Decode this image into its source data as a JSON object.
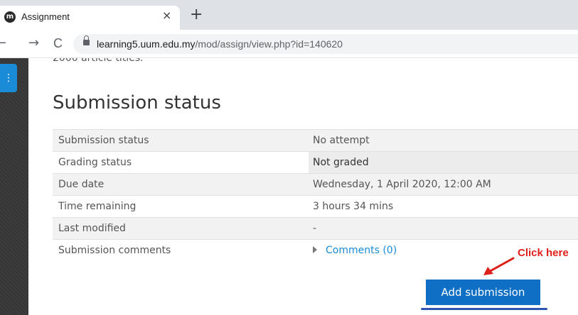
{
  "browser": {
    "tab_title": "Assignment",
    "tab_close": "×",
    "new_tab": "+",
    "back": "←",
    "forward": "→",
    "reload": "C",
    "url_host": "learning5.uum.edu.my",
    "url_path": "/mod/assign/view.php?id=140620",
    "favicon": "m"
  },
  "page": {
    "cut_off_text": "2000 article titles.",
    "heading": "Submission status",
    "rows": [
      {
        "label": "Submission status",
        "value": "No attempt"
      },
      {
        "label": "Grading status",
        "value": "Not graded"
      },
      {
        "label": "Due date",
        "value": "Wednesday, 1 April 2020, 12:00 AM"
      },
      {
        "label": "Time remaining",
        "value": "3 hours 34 mins"
      },
      {
        "label": "Last modified",
        "value": "-"
      },
      {
        "label": "Submission comments",
        "value": "Comments (0)"
      }
    ],
    "add_submission_label": "Add submission"
  },
  "annotation": {
    "text": "Click here",
    "color": "#e0201a",
    "underline_color": "#2f56b0"
  },
  "icons": {
    "rail_button": "menu-toggle-icon",
    "lock": "lock-icon",
    "comments_toggle": "triangle-right-icon"
  },
  "colors": {
    "primary_button": "#0f6fc5",
    "link": "#1a8bd6",
    "rail": "#3d3d3d"
  }
}
